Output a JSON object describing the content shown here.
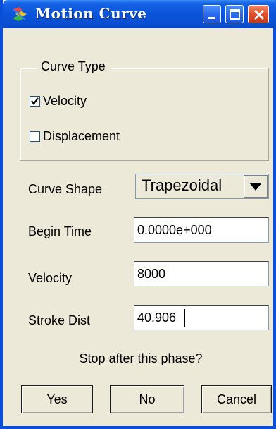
{
  "window": {
    "title": "Motion Curve",
    "controls": {
      "minimize": "minimize-icon",
      "maximize": "maximize-icon",
      "close": "close-icon"
    }
  },
  "curve_type": {
    "legend": "Curve Type",
    "options": [
      {
        "label": "Velocity",
        "checked": true
      },
      {
        "label": "Displacement",
        "checked": false
      }
    ]
  },
  "fields": {
    "curve_shape": {
      "label": "Curve Shape",
      "value": "Trapezoidal"
    },
    "begin_time": {
      "label": "Begin Time",
      "value": "0.0000e+000"
    },
    "velocity": {
      "label": "Velocity",
      "value": "8000"
    },
    "stroke_dist": {
      "label": "Stroke Dist",
      "value": "40.906"
    }
  },
  "prompt": "Stop after this phase?",
  "buttons": {
    "yes": "Yes",
    "no": "No",
    "cancel": "Cancel"
  },
  "colors": {
    "titlebar": "#0a53d8",
    "face": "#ece9d8",
    "close": "#e0502c"
  }
}
